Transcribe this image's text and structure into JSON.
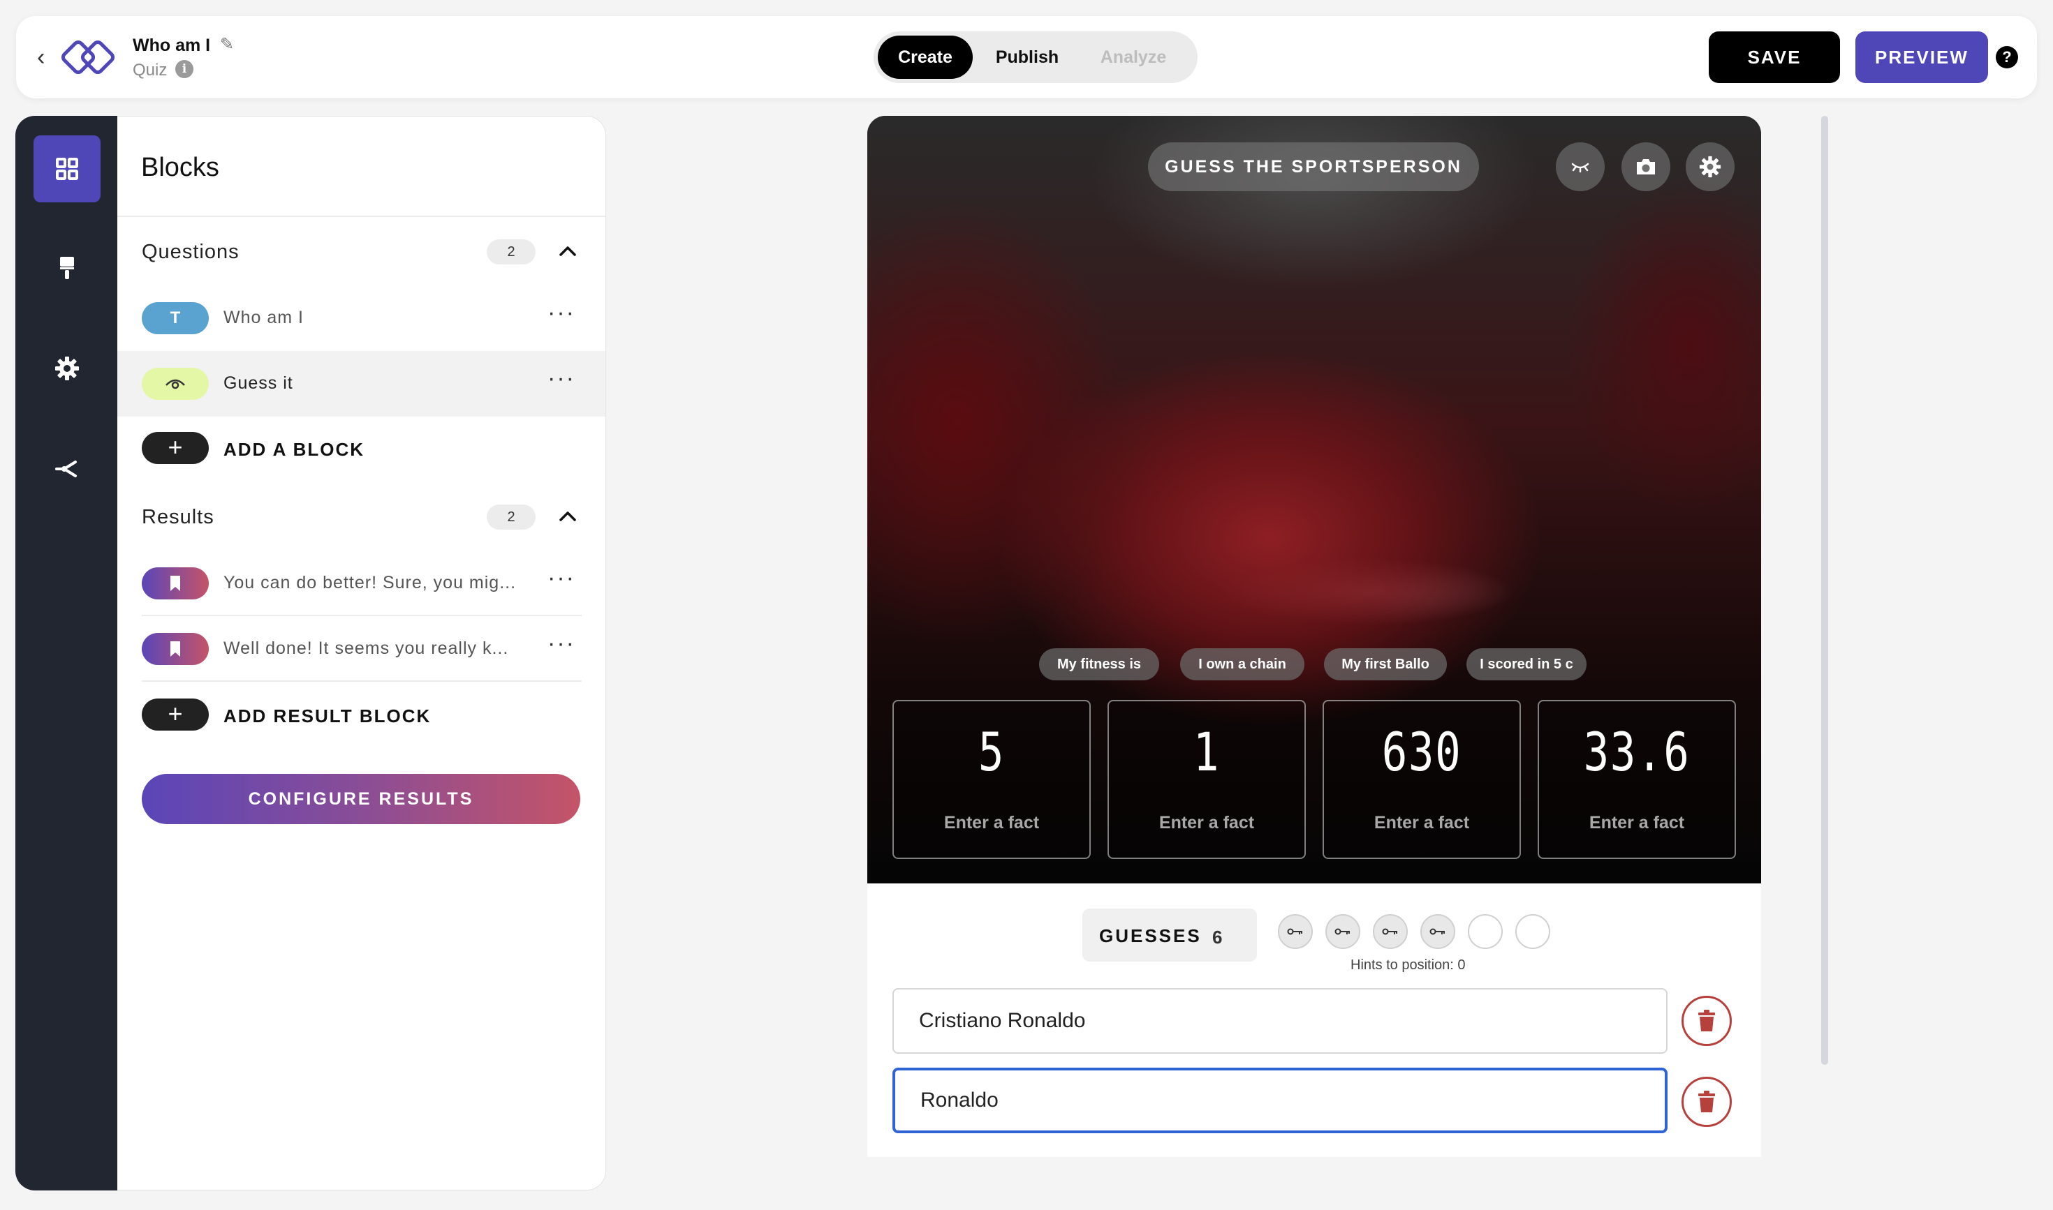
{
  "header": {
    "title": "Who am I",
    "subtitle": "Quiz",
    "tabs": [
      {
        "label": "Create",
        "active": true
      },
      {
        "label": "Publish",
        "active": false
      },
      {
        "label": "Analyze",
        "active": false,
        "disabled": true
      }
    ],
    "save_label": "SAVE",
    "preview_label": "PREVIEW"
  },
  "rail": {
    "items": [
      {
        "icon": "grid-icon",
        "active": true
      },
      {
        "icon": "paint-brush-icon",
        "active": false
      },
      {
        "icon": "gear-icon",
        "active": false
      },
      {
        "icon": "branch-icon",
        "active": false
      }
    ]
  },
  "blocks": {
    "title": "Blocks",
    "questions": {
      "label": "Questions",
      "count": "2",
      "items": [
        {
          "badge": "T",
          "label": "Who am I",
          "badge_color": "#5aa2d0"
        },
        {
          "badge_icon": "eye-icon",
          "label": "Guess it",
          "badge_color": "#e3f7a6",
          "selected": true
        }
      ],
      "add_label": "ADD A BLOCK"
    },
    "results": {
      "label": "Results",
      "count": "2",
      "items": [
        {
          "badge_icon": "bookmark-icon",
          "label": "You can do better! Sure, you mig..."
        },
        {
          "badge_icon": "bookmark-icon",
          "label": "Well done! It seems you really k..."
        }
      ],
      "add_label": "ADD RESULT BLOCK"
    },
    "configure_label": "CONFIGURE RESULTS"
  },
  "preview": {
    "game_title": "GUESS THE SPORTSPERSON",
    "fact_chips": [
      "My fitness is",
      "I own a chain",
      "My first Ballo",
      "I scored in 5 c"
    ],
    "facts": [
      {
        "value": "5",
        "label": "Enter a fact"
      },
      {
        "value": "1",
        "label": "Enter a fact"
      },
      {
        "value": "630",
        "label": "Enter a fact"
      },
      {
        "value": "33.6",
        "label": "Enter a fact"
      }
    ],
    "guesses_label": "GUESSES",
    "guesses_count": "6",
    "hint_slots": {
      "filled": 4,
      "total": 6
    },
    "hints_text": "Hints to position: 0",
    "answers": [
      "Cristiano Ronaldo",
      "Ronaldo"
    ]
  },
  "colors": {
    "accent": "#4f46b8",
    "rail_bg": "#222631",
    "danger": "#b5403c",
    "focus": "#2f64d6"
  }
}
